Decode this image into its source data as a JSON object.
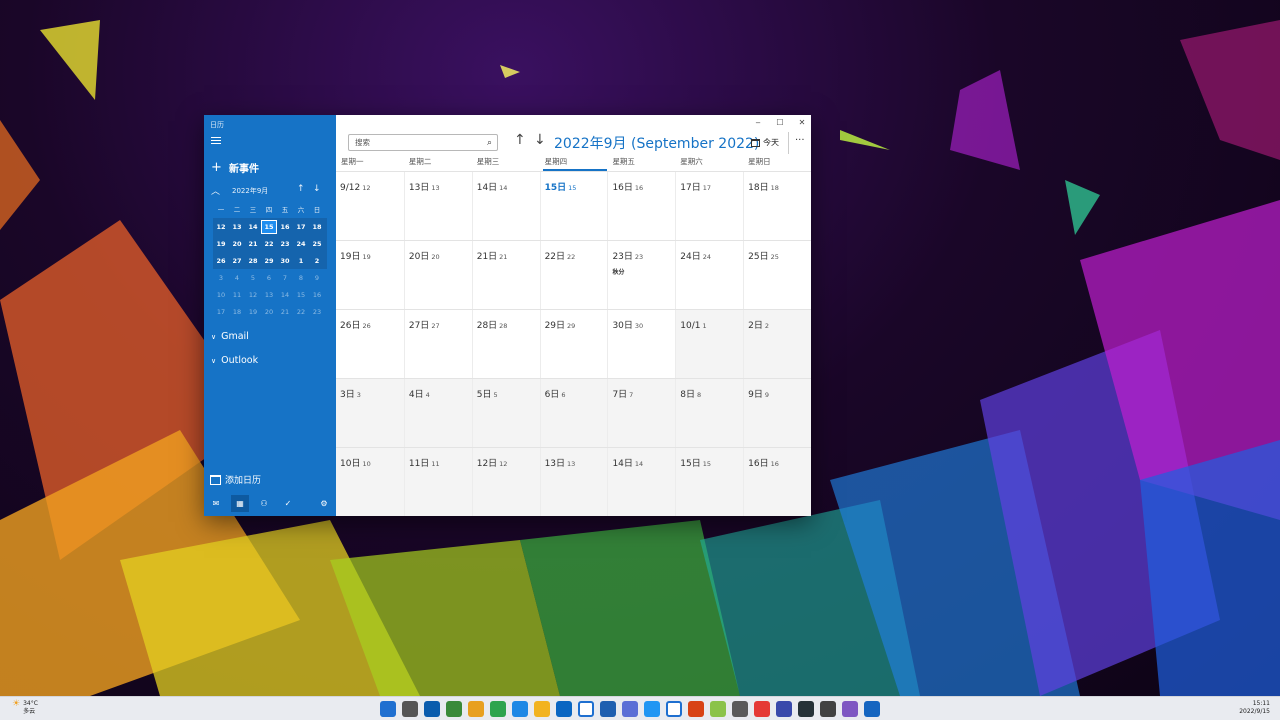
{
  "app": {
    "title": "日历"
  },
  "window_controls": {
    "minimize": "‒",
    "maximize": "☐",
    "close": "✕"
  },
  "sidebar": {
    "new_event": "新事件",
    "mini_calendar": {
      "month_label": "2022年9月",
      "weekdays": [
        "一",
        "二",
        "三",
        "四",
        "五",
        "六",
        "日"
      ],
      "weeks": [
        {
          "days": [
            "12",
            "13",
            "14",
            "15",
            "16",
            "17",
            "18"
          ],
          "current": true
        },
        {
          "days": [
            "19",
            "20",
            "21",
            "22",
            "23",
            "24",
            "25"
          ],
          "current": true
        },
        {
          "days": [
            "26",
            "27",
            "28",
            "29",
            "30",
            "1",
            "2"
          ],
          "current": true
        },
        {
          "days": [
            "3",
            "4",
            "5",
            "6",
            "7",
            "8",
            "9"
          ],
          "current": false
        },
        {
          "days": [
            "10",
            "11",
            "12",
            "13",
            "14",
            "15",
            "16"
          ],
          "current": false
        },
        {
          "days": [
            "17",
            "18",
            "19",
            "20",
            "21",
            "22",
            "23"
          ],
          "current": false
        }
      ],
      "today": "15"
    },
    "accounts": [
      "Gmail",
      "Outlook"
    ],
    "add_calendar": "添加日历",
    "bottom_nav": [
      "mail",
      "calendar",
      "people",
      "todo",
      "settings"
    ]
  },
  "main": {
    "search_placeholder": "搜索",
    "title": "2022年9月 (September 2022)",
    "today_button": "今天",
    "more": "···",
    "weekdays": [
      "星期一",
      "星期二",
      "星期三",
      "星期四",
      "星期五",
      "星期六",
      "星期日"
    ],
    "today_column": 3,
    "weeks": [
      [
        {
          "d": "9/12",
          "l": "12"
        },
        {
          "d": "13日",
          "l": "13"
        },
        {
          "d": "14日",
          "l": "14"
        },
        {
          "d": "15日",
          "l": "15",
          "today": true
        },
        {
          "d": "16日",
          "l": "16"
        },
        {
          "d": "17日",
          "l": "17"
        },
        {
          "d": "18日",
          "l": "18"
        }
      ],
      [
        {
          "d": "19日",
          "l": "19"
        },
        {
          "d": "20日",
          "l": "20"
        },
        {
          "d": "21日",
          "l": "21"
        },
        {
          "d": "22日",
          "l": "22"
        },
        {
          "d": "23日",
          "l": "23",
          "holiday": "秋分"
        },
        {
          "d": "24日",
          "l": "24"
        },
        {
          "d": "25日",
          "l": "25"
        }
      ],
      [
        {
          "d": "26日",
          "l": "26"
        },
        {
          "d": "27日",
          "l": "27"
        },
        {
          "d": "28日",
          "l": "28"
        },
        {
          "d": "29日",
          "l": "29"
        },
        {
          "d": "30日",
          "l": "30"
        },
        {
          "d": "10/1",
          "l": "1",
          "other": true
        },
        {
          "d": "2日",
          "l": "2",
          "other": true
        }
      ],
      [
        {
          "d": "3日",
          "l": "3",
          "other": true
        },
        {
          "d": "4日",
          "l": "4",
          "other": true
        },
        {
          "d": "5日",
          "l": "5",
          "other": true
        },
        {
          "d": "6日",
          "l": "6",
          "other": true
        },
        {
          "d": "7日",
          "l": "7",
          "other": true
        },
        {
          "d": "8日",
          "l": "8",
          "other": true
        },
        {
          "d": "9日",
          "l": "9",
          "other": true
        }
      ],
      [
        {
          "d": "10日",
          "l": "10",
          "other": true
        },
        {
          "d": "11日",
          "l": "11",
          "other": true
        },
        {
          "d": "12日",
          "l": "12",
          "other": true
        },
        {
          "d": "13日",
          "l": "13",
          "other": true
        },
        {
          "d": "14日",
          "l": "14",
          "other": true
        },
        {
          "d": "15日",
          "l": "15",
          "other": true
        },
        {
          "d": "16日",
          "l": "16",
          "other": true
        }
      ]
    ]
  },
  "taskbar": {
    "weather_temp": "34°C",
    "weather_desc": "多云",
    "time": "15:11",
    "date": "2022/9/15",
    "app_colors": [
      "#1f6fd0",
      "#555555",
      "#0b5cad",
      "#3a8a3a",
      "#e8a020",
      "#2da44e",
      "#1e88e5",
      "#f2b320",
      "#0a66c2",
      "#ffffff",
      "#1e5fb0",
      "#5b6fd6",
      "#2196f3",
      "#ffffff",
      "#d84315",
      "#8bc34a",
      "#5a5a5a",
      "#e53935",
      "#3949ab",
      "#263238",
      "#424242",
      "#7e57c2",
      "#1565c0"
    ]
  },
  "accent_color": "#1673c6"
}
